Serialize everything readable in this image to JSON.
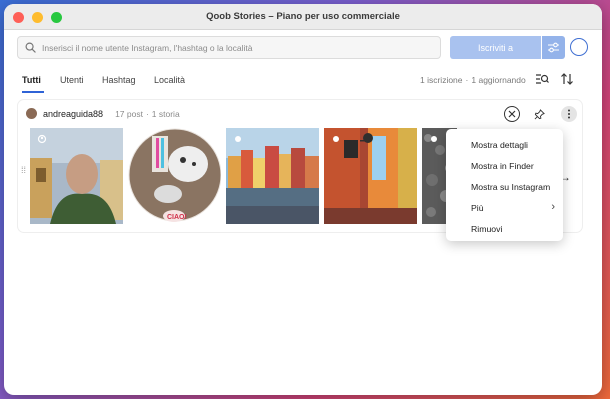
{
  "window": {
    "title": "Qoob Stories – Piano per uso commerciale"
  },
  "traffic_colors": {
    "close": "#fe5f57",
    "minimize": "#febc2e",
    "zoom": "#28c840"
  },
  "search": {
    "placeholder": "Inserisci il nome utente Instagram, l'hashtag o la località",
    "value": "",
    "subscribe_label": "Iscriviti a"
  },
  "tabs": [
    {
      "label": "Tutti",
      "active": true
    },
    {
      "label": "Utenti",
      "active": false
    },
    {
      "label": "Hashtag",
      "active": false
    },
    {
      "label": "Località",
      "active": false
    }
  ],
  "status": {
    "subscriptions": "1 iscrizione",
    "updating": "1 aggiornando"
  },
  "account": {
    "username": "andreaguida88",
    "posts": "17 post",
    "stories": "1 storia",
    "icons": [
      "remove-circle-icon",
      "pin-icon",
      "more-vertical-icon"
    ]
  },
  "context_menu": {
    "items": [
      {
        "label": "Mostra dettagli"
      },
      {
        "label": "Mostra in Finder"
      },
      {
        "label": "Mostra su Instagram"
      },
      {
        "label": "Più",
        "submenu": true
      },
      {
        "label": "Rimuovi"
      }
    ]
  },
  "colors": {
    "accent": "#2f63d6",
    "subscribe_button": "#a9c2ef"
  }
}
